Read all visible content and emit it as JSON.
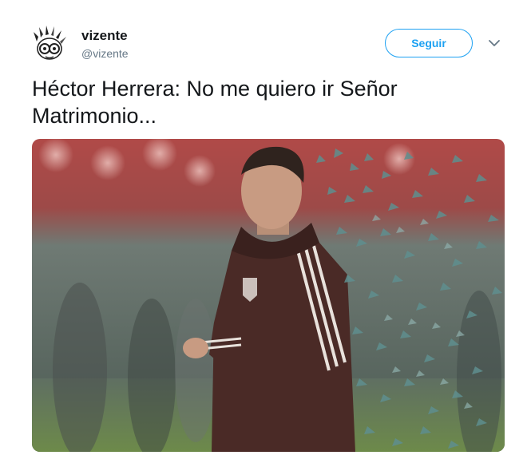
{
  "tweet": {
    "display_name": "vizente",
    "handle": "@vizente",
    "follow_label": "Seguir",
    "text": "Héctor Herrera: No me quiero ir Señor Matrimonio...",
    "more_icon": "chevron-down-icon",
    "avatar_icon": "cartoon-avatar"
  },
  "colors": {
    "accent": "#1da1f2",
    "text": "#14171a",
    "secondary": "#657786",
    "jacket": "#4a2a26",
    "shard": "#5f8f8f"
  }
}
